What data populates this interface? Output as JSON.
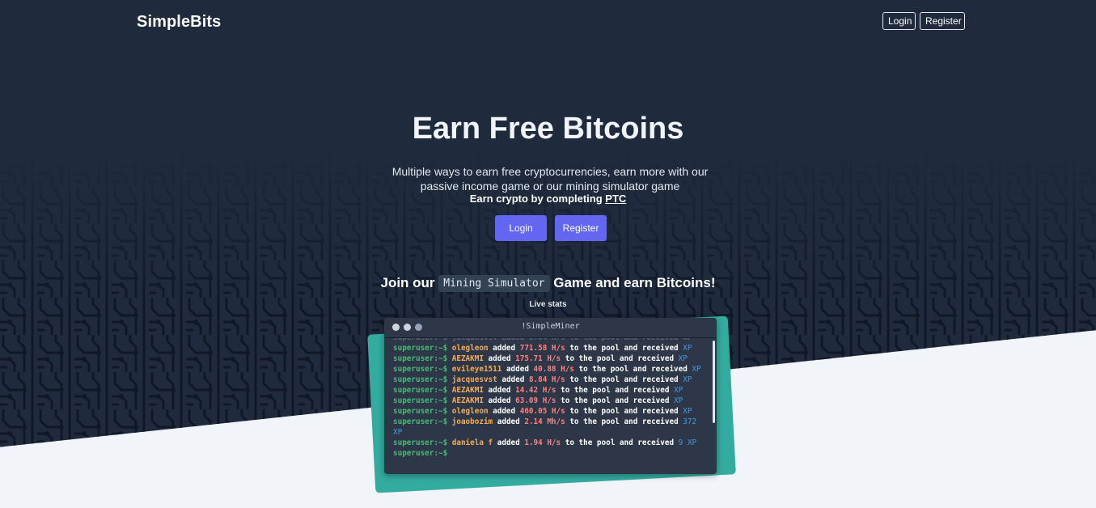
{
  "brand": "SimpleBits",
  "nav": {
    "login": "Login",
    "register": "Register"
  },
  "hero": {
    "title": "Earn Free Bitcoins",
    "subtitle": "Multiple ways to earn free cryptocurrencies, earn more with our passive income game or our mining simulator game",
    "ptc_prefix": "Earn crypto by completing ",
    "ptc_link": "PTC",
    "login_button": "Login",
    "register_button": "Register"
  },
  "join": {
    "prefix": "Join our ",
    "code": "Mining Simulator",
    "suffix": " Game and earn Bitcoins!"
  },
  "live_stats_label": "Live stats",
  "terminal": {
    "title": "!SimpleMiner",
    "lines": [
      {
        "prompt": "superuser:~$",
        "user": "olegleon",
        "rate": "771.58 H/s",
        "xp": "XP"
      },
      {
        "prompt": "superuser:~$",
        "user": "AEZAKMI",
        "rate": "175.71 H/s",
        "xp": "XP"
      },
      {
        "prompt": "superuser:~$",
        "user": "evileye1511",
        "rate": "40.88 H/s",
        "xp": "XP"
      },
      {
        "prompt": "superuser:~$",
        "user": "jacquesvst",
        "rate": "8.84 H/s",
        "xp": "XP"
      },
      {
        "prompt": "superuser:~$",
        "user": "AEZAKMI",
        "rate": "14.42 H/s",
        "xp": "XP"
      },
      {
        "prompt": "superuser:~$",
        "user": "AEZAKMI",
        "rate": "63.09 H/s",
        "xp": "XP"
      },
      {
        "prompt": "superuser:~$",
        "user": "olegleon",
        "rate": "460.05 H/s",
        "xp": "XP"
      },
      {
        "prompt": "superuser:~$",
        "user": "joaobozim",
        "rate": "2.14 Mh/s",
        "xp": "372 XP"
      },
      {
        "prompt": "superuser:~$",
        "user": "daniela f",
        "rate": "1.94 H/s",
        "xp": "9 XP"
      }
    ],
    "last_prompt": "superuser:~$",
    "added_word": "added",
    "middle_text": "to the pool and received"
  },
  "colors": {
    "hero_bg": "#1f2a3c",
    "accent": "#6366f1",
    "teal": "#33ab9f",
    "terminal_bg": "#2d3748"
  }
}
